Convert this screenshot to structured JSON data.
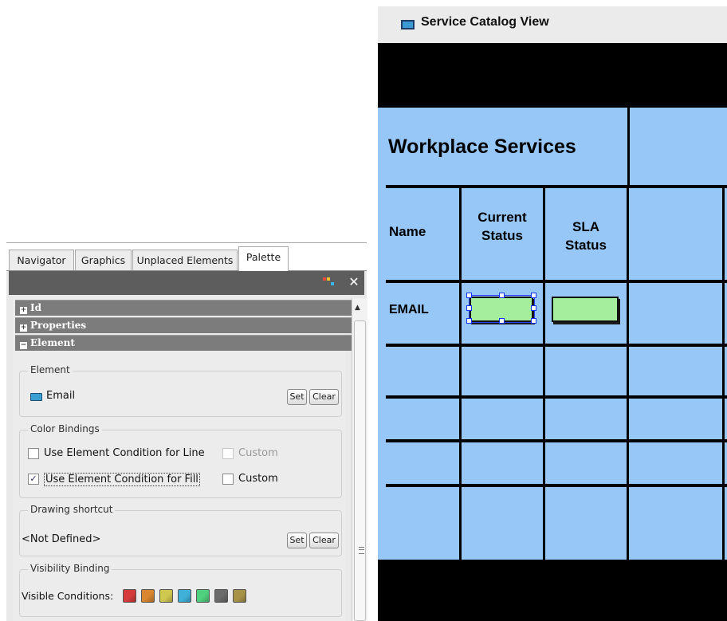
{
  "palette": {
    "tabs": [
      {
        "label": "Navigator",
        "active": false
      },
      {
        "label": "Graphics",
        "active": false
      },
      {
        "label": "Unplaced Elements",
        "active": false
      },
      {
        "label": "Palette",
        "active": true
      }
    ],
    "toolbar": {
      "close_symbol": "✕"
    },
    "sections": [
      {
        "label": "Id",
        "state": "+"
      },
      {
        "label": "Properties",
        "state": "+"
      },
      {
        "label": "Element",
        "state": "−"
      }
    ],
    "element_group": {
      "title": "Element",
      "element_name": "Email",
      "set_label": "Set",
      "clear_label": "Clear"
    },
    "color_bindings": {
      "title": "Color Bindings",
      "line_label": "Use Element Condition for Line",
      "line_checked": false,
      "line_custom_label": "Custom",
      "fill_label": "Use Element Condition for Fill",
      "fill_checked": true,
      "fill_custom_label": "Custom",
      "check_mark": "✓"
    },
    "drawing_shortcut": {
      "title": "Drawing shortcut",
      "value": "<Not Defined>",
      "set_label": "Set",
      "clear_label": "Clear"
    },
    "visibility_binding": {
      "title": "Visibility Binding",
      "label": "Visible Conditions:",
      "swatches": [
        "#d63b3b",
        "#d8862f",
        "#cfc84e",
        "#3fb1d8",
        "#4fd07e",
        "#6b6b6b",
        "#a89248"
      ]
    }
  },
  "canvas": {
    "title": "Service Catalog View",
    "header": "Workplace Services",
    "columns": [
      "Name",
      "Current\nStatus",
      "SLA\nStatus"
    ],
    "rows": [
      {
        "name": "EMAIL"
      }
    ],
    "colors": {
      "table_bg": "#96c7f7",
      "status_fill": "#a4ee9e",
      "bar": "#000000"
    }
  }
}
